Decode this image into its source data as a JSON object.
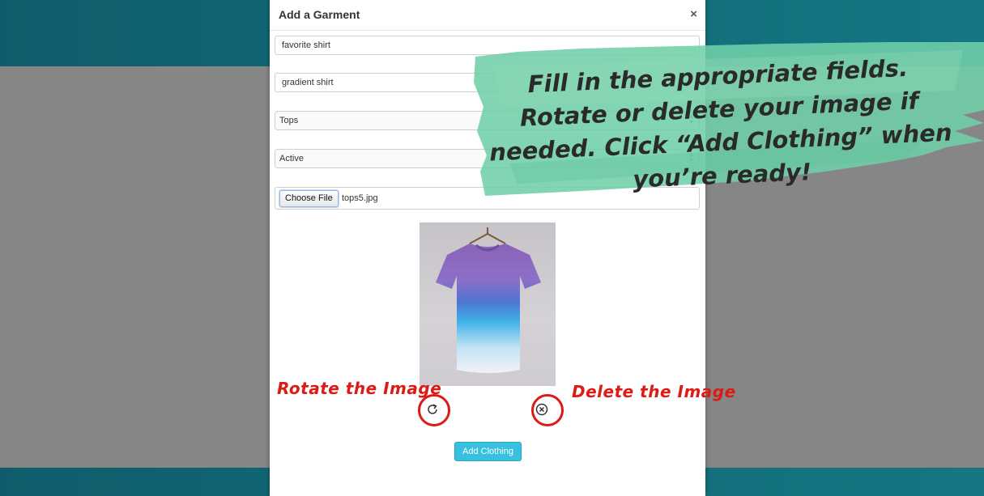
{
  "modal": {
    "title": "Add a Garment",
    "close_glyph": "×",
    "fields": {
      "name_value": "favorite shirt",
      "description_value": "gradient shirt",
      "category_value": "Tops",
      "status_value": "Active"
    },
    "file": {
      "button_label": "Choose File",
      "file_name": "tops5.jpg"
    },
    "image_controls": {
      "rotate_icon": "rotate-icon",
      "delete_icon": "delete-circle-icon"
    },
    "submit_label": "Add Clothing"
  },
  "annotations": {
    "callout_text": "Fill in the appropriate fields. Rotate or delete your image if needed. Click “Add Clothing” when you’re ready!",
    "rotate_label": "Rotate the Image",
    "delete_label": "Delete the Image"
  },
  "colors": {
    "header_teal": "#126976",
    "annotation_red": "#dd1a14",
    "callout_green": "#6fcfa8",
    "button_blue": "#37c1df"
  }
}
